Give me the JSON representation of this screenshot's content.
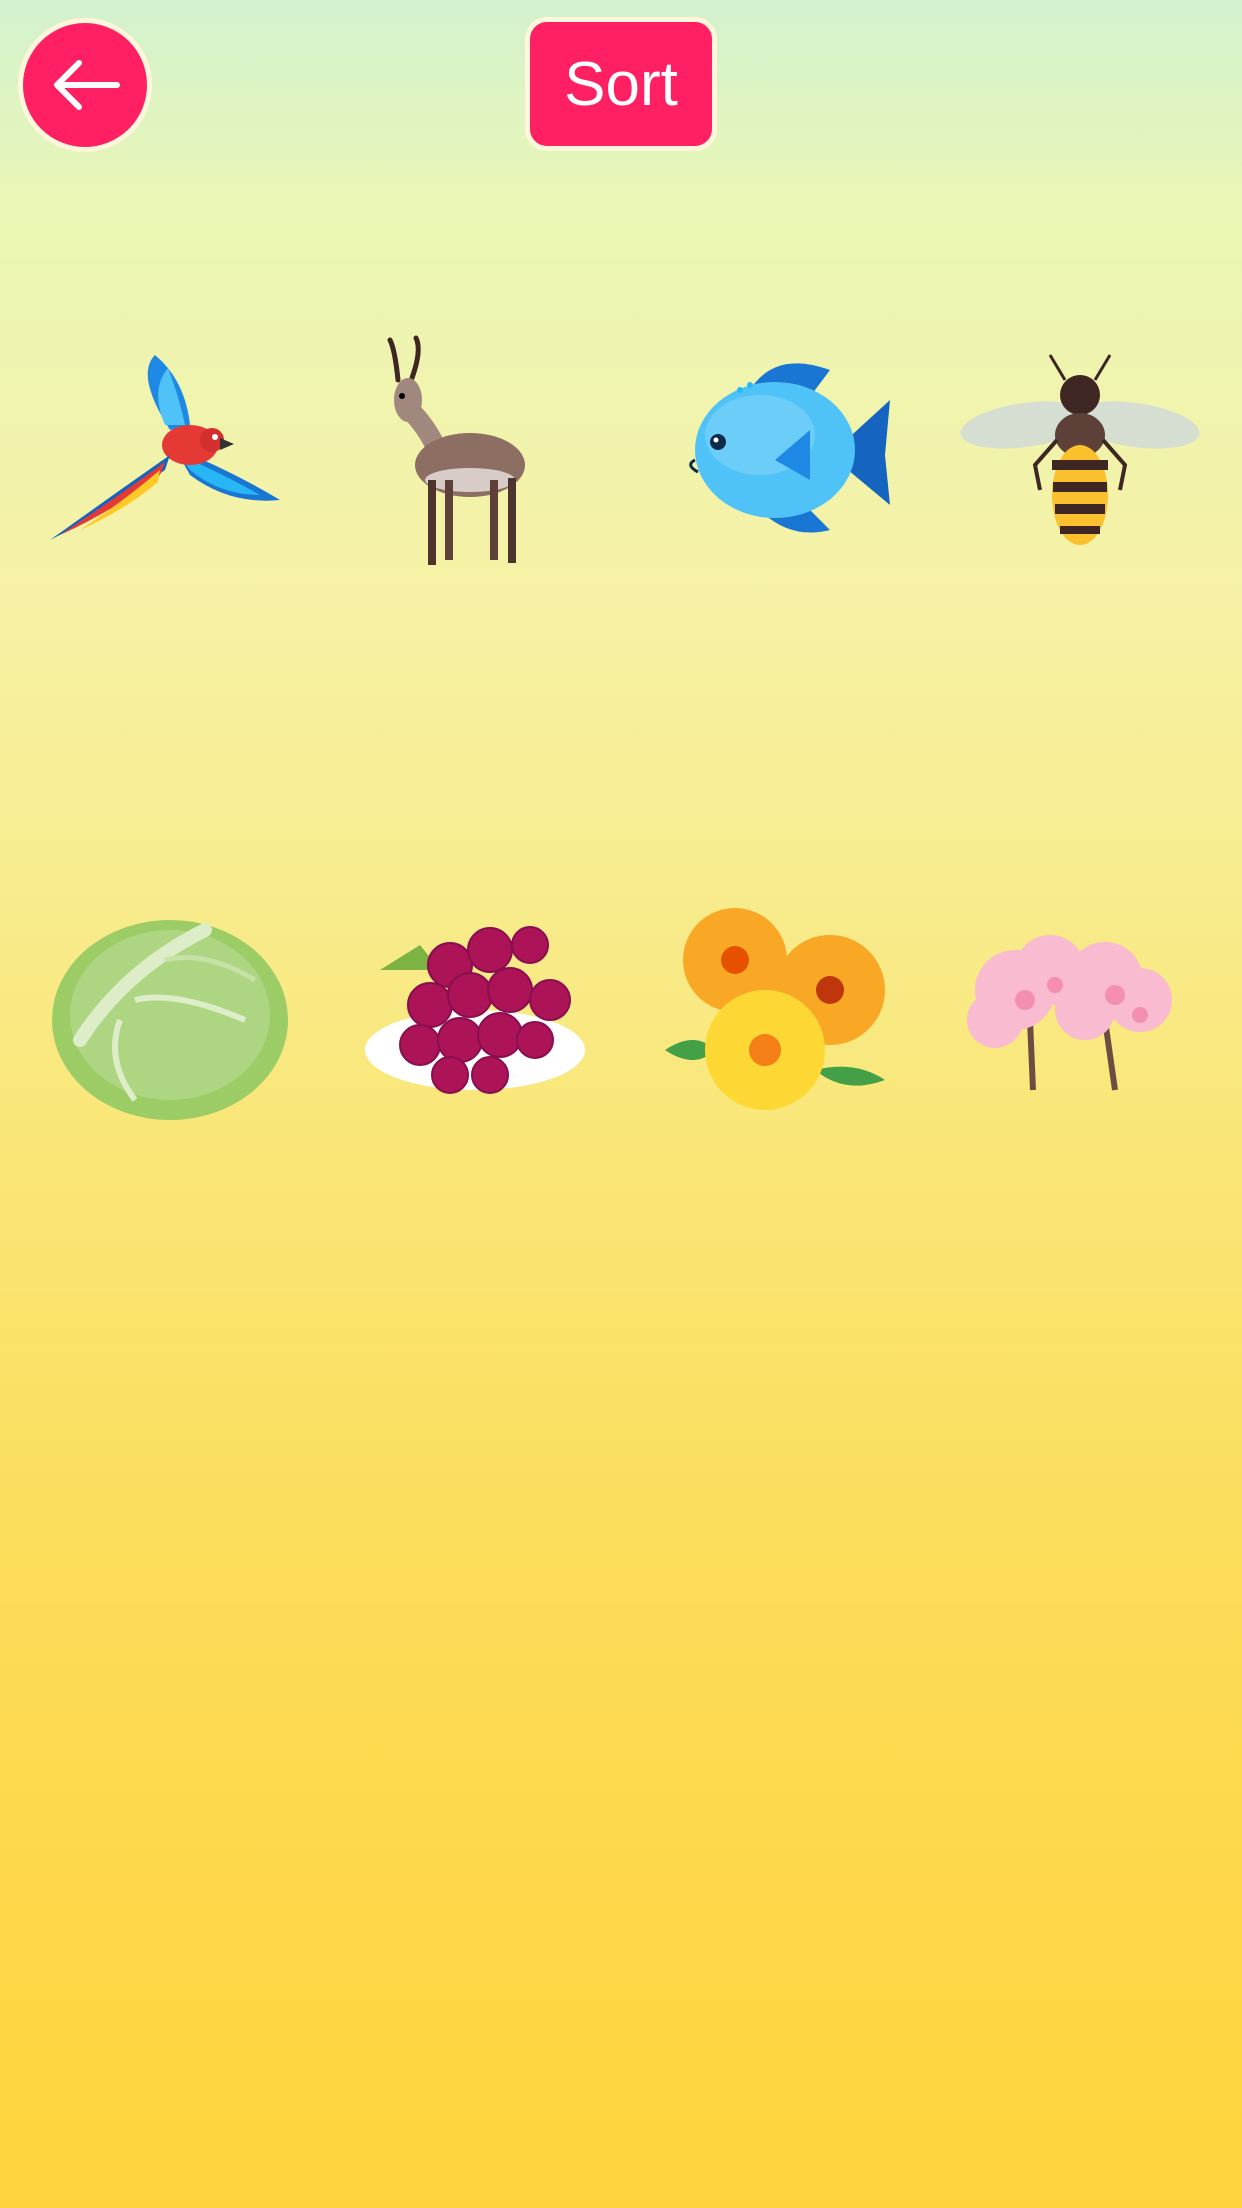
{
  "header": {
    "back_icon": "arrow-left-icon",
    "sort_label": "Sort"
  },
  "items": [
    {
      "name": "parrot",
      "icon": "parrot-icon"
    },
    {
      "name": "antelope",
      "icon": "antelope-icon"
    },
    {
      "name": "fish",
      "icon": "fish-icon"
    },
    {
      "name": "bee",
      "icon": "bee-icon"
    },
    {
      "name": "cabbage",
      "icon": "cabbage-icon"
    },
    {
      "name": "grapes",
      "icon": "grapes-icon"
    },
    {
      "name": "flowers",
      "icon": "flowers-icon"
    },
    {
      "name": "cherry-blossom-trees",
      "icon": "cherry-tree-icon"
    }
  ],
  "colors": {
    "accent": "#ff1f63",
    "button_border": "#fff6dc",
    "background_top": "#d3f2cf",
    "background_bottom": "#ffd43b"
  }
}
